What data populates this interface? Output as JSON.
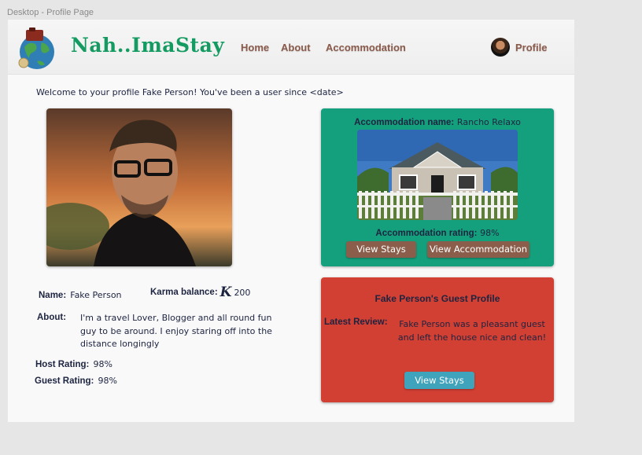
{
  "frame_label": "Desktop - Profile Page",
  "header": {
    "brand": "Nah..ImaStay",
    "nav": {
      "home": "Home",
      "about": "About",
      "accommodation": "Accommodation",
      "profile": "Profile"
    }
  },
  "welcome": "Welcome to your profile Fake Person! You've been a user since <date>",
  "user": {
    "name_label": "Name:",
    "name": "Fake Person",
    "karma_label": "Karma balance:",
    "karma_symbol": "K",
    "karma_value": "200",
    "about_label": "About:",
    "about": "I'm a travel Lover, Blogger and all round fun guy to be around. I enjoy staring off into the distance longingly",
    "host_rating_label": "Host Rating:",
    "host_rating": "98%",
    "guest_rating_label": "Guest Rating:",
    "guest_rating": "98%"
  },
  "accommodation": {
    "name_label": "Accommodation name:",
    "name": "Rancho Relaxo",
    "rating_label": "Accommodation rating:",
    "rating": "98%",
    "view_stays": "View Stays",
    "view_accommodation": "View Accommodation"
  },
  "guest_profile": {
    "title": "Fake Person's Guest Profile",
    "review_label": "Latest Review:",
    "review": "Fake Person was a pleasant guest and left the house nice and clean!",
    "view_stays": "View Stays"
  },
  "colors": {
    "brand": "#149b61",
    "nav": "#8a5a4a",
    "accommodation_card": "#14a07d",
    "guest_card": "#d23f33",
    "brown_button": "#8b5e4b",
    "blue_button": "#3fa3bc"
  }
}
